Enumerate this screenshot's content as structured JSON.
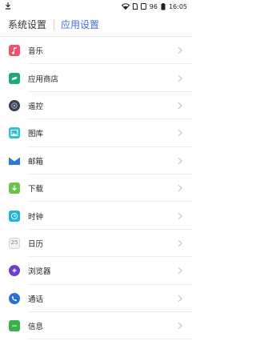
{
  "status_bar": {
    "battery_level": "96",
    "time": "16:05"
  },
  "tabs": {
    "system_label": "系统设置",
    "apps_label": "应用设置"
  },
  "apps": [
    {
      "label": "音乐",
      "icon": "music-note-icon",
      "color": "#f0506e"
    },
    {
      "label": "应用商店",
      "icon": "app-store-icon",
      "color": "#1fa67a"
    },
    {
      "label": "遥控",
      "icon": "remote-control-icon",
      "color": "#3a3f4b"
    },
    {
      "label": "图库",
      "icon": "gallery-icon",
      "color": "#2ec0d6"
    },
    {
      "label": "邮箱",
      "icon": "mail-icon",
      "color": "#2d7ad6"
    },
    {
      "label": "下载",
      "icon": "download-icon",
      "color": "#6cc24a"
    },
    {
      "label": "时钟",
      "icon": "clock-icon",
      "color": "#1fb4d9"
    },
    {
      "label": "日历",
      "icon": "calendar-icon",
      "color": "#9aa0a6"
    },
    {
      "label": "浏览器",
      "icon": "browser-icon",
      "color": "#6f3fc9"
    },
    {
      "label": "通话",
      "icon": "phone-icon",
      "color": "#2a6fd1"
    },
    {
      "label": "信息",
      "icon": "messages-icon",
      "color": "#3bb04a"
    }
  ],
  "calendar_day": "25"
}
